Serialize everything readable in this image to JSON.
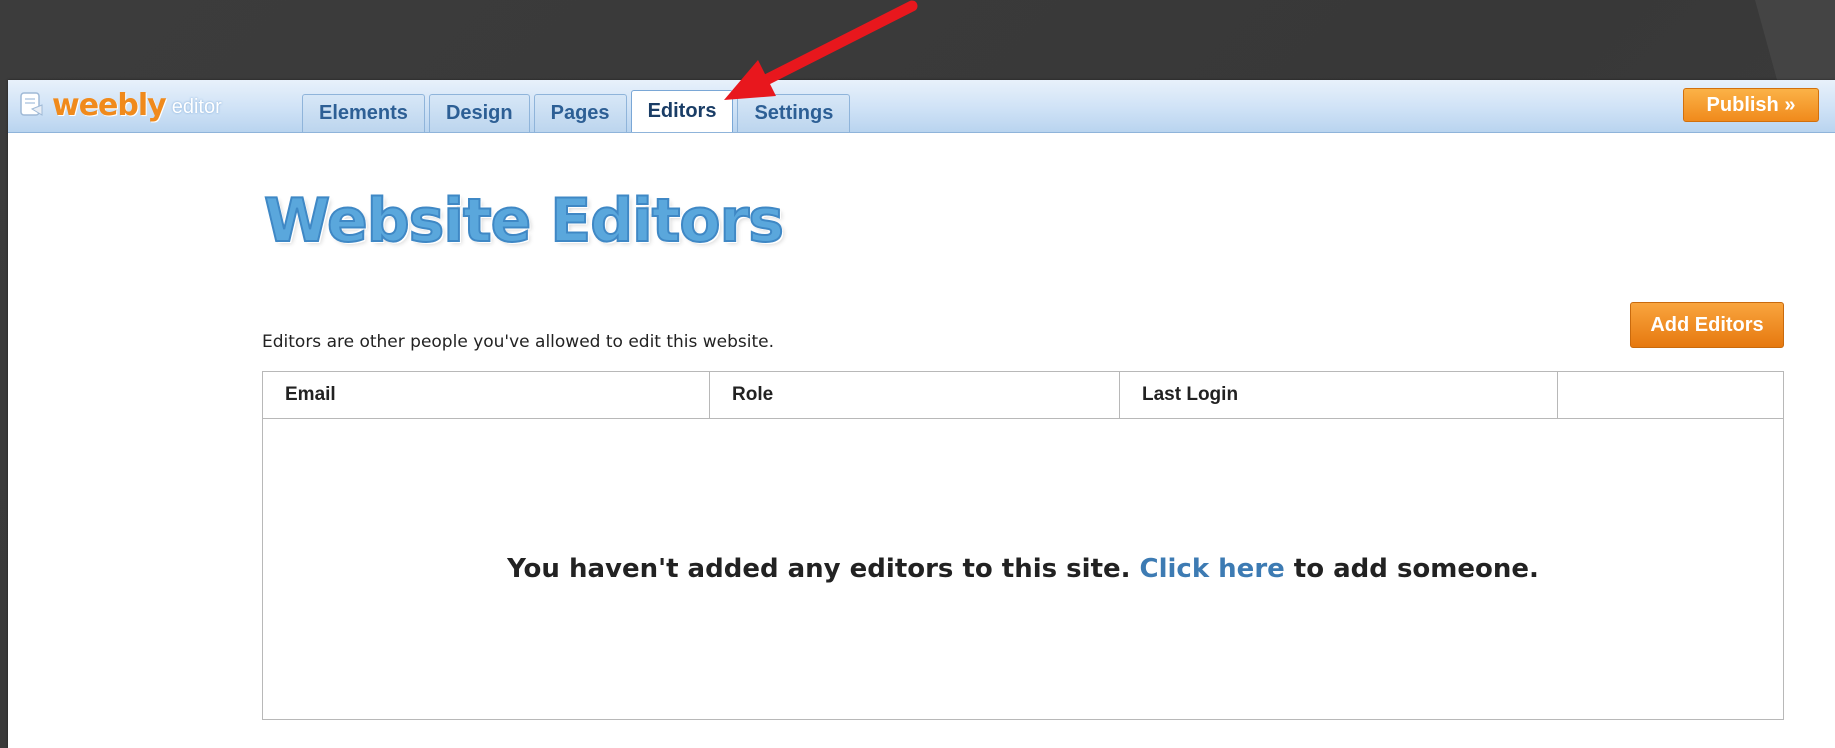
{
  "app": {
    "logo_word": "weebly",
    "logo_sub": "editor"
  },
  "tabs": [
    {
      "label": "Elements",
      "active": false
    },
    {
      "label": "Design",
      "active": false
    },
    {
      "label": "Pages",
      "active": false
    },
    {
      "label": "Editors",
      "active": true
    },
    {
      "label": "Settings",
      "active": false
    }
  ],
  "toolbar": {
    "publish_label": "Publish »"
  },
  "page": {
    "heading": "Website Editors",
    "description": "Editors are other people you've allowed to edit this website.",
    "add_button_label": "Add Editors"
  },
  "table": {
    "columns": [
      "Email",
      "Role",
      "Last Login",
      ""
    ],
    "empty_before": "You haven't added any editors to this site.",
    "empty_link": "Click here",
    "empty_after": "to add someone."
  },
  "colors": {
    "brand_orange": "#f08a1c",
    "heading_blue": "#5aa7dc",
    "link_blue": "#3d7bb3",
    "arrow_red": "#e8171d",
    "topbar_blue": "#cfe2f6"
  },
  "icons": {
    "logo": "weebly-logo-icon",
    "annotation": "red-arrow-icon"
  }
}
